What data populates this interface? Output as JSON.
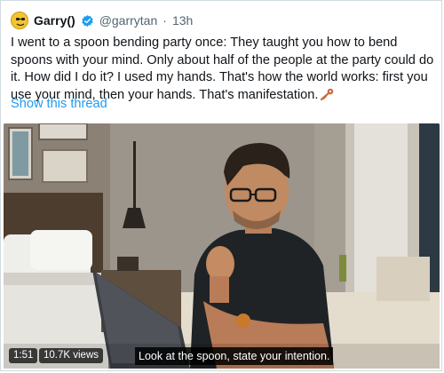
{
  "tweet": {
    "display_name": "Garry()",
    "handle": "@garrytan",
    "separator": "·",
    "time": "13h",
    "text": "I went to a spoon bending party once: They taught you how to bend spoons with your mind. Only about half of the people at the party could do it. How did I do it? I used my hands. That's how the world works: first you use your mind, then your hands. That's manifestation.",
    "text_emoji": "key-emoji",
    "show_thread": "Show this thread"
  },
  "video": {
    "duration": "1:51",
    "views": "10.7K views",
    "caption": "Look at the spoon, state your intention."
  },
  "colors": {
    "link": "#1d9bf0",
    "verified": "#1d9bf0",
    "muted": "#536471",
    "text": "#0f1419"
  },
  "icons": {
    "verified": "verified-badge-icon",
    "avatar": "avatar"
  }
}
